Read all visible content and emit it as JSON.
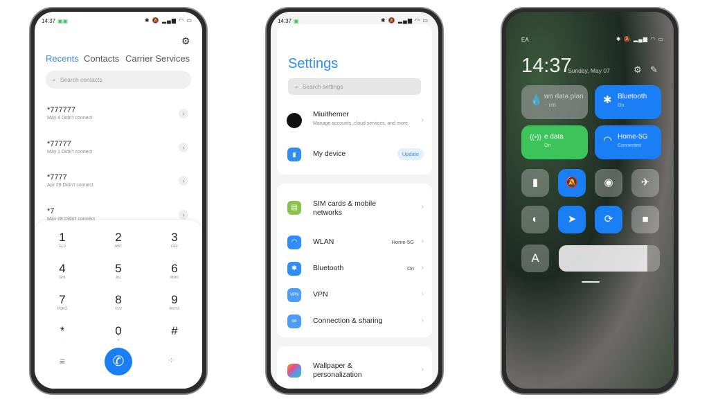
{
  "phone1": {
    "status": {
      "time": "14:37",
      "icons": "✱ 🔕 ▂▄▆ ◠ ▭"
    },
    "tabs": [
      "Recents",
      "Contacts",
      "Carrier Services"
    ],
    "search_placeholder": "Search contacts",
    "calls": [
      {
        "number": "*777777",
        "detail": "May 4 Didn't connect"
      },
      {
        "number": "*77777",
        "detail": "May 1 Didn't connect"
      },
      {
        "number": "*7777",
        "detail": "Apr 29 Didn't connect"
      },
      {
        "number": "*7",
        "detail": "May 28 Didn't connect"
      }
    ],
    "keys": [
      [
        "1",
        "GLD"
      ],
      [
        "2",
        "ABC"
      ],
      [
        "3",
        "DEF"
      ],
      [
        "4",
        "GHI"
      ],
      [
        "5",
        "JKL"
      ],
      [
        "6",
        "MNO"
      ],
      [
        "7",
        "PQRS"
      ],
      [
        "8",
        "TUV"
      ],
      [
        "9",
        "WXYZ"
      ],
      [
        "*",
        "·"
      ],
      [
        "0",
        "+"
      ],
      [
        "#",
        ""
      ]
    ],
    "accent": "#1a7ff5"
  },
  "phone2": {
    "status": {
      "time": "14:37",
      "icons": "✱ 🔕 ▂▄▆ ◠ ▭"
    },
    "title": "Settings",
    "search_placeholder": "Search settings",
    "account": {
      "name": "Miuithemer",
      "desc": "Manage accounts, cloud services, and more"
    },
    "device": {
      "label": "My device",
      "badge": "Update"
    },
    "network": [
      {
        "label": "SIM cards & mobile networks",
        "value": "",
        "color": "#8bc34a",
        "icon": "sim-icon"
      },
      {
        "label": "WLAN",
        "value": "Home-5G",
        "color": "#2f8df5",
        "icon": "wifi-icon"
      },
      {
        "label": "Bluetooth",
        "value": "On",
        "color": "#2f8df5",
        "icon": "bluetooth-icon"
      },
      {
        "label": "VPN",
        "value": "",
        "color": "#4f9cf5",
        "icon": "vpn-icon"
      },
      {
        "label": "Connection & sharing",
        "value": "",
        "color": "#4f9cf5",
        "icon": "link-icon"
      }
    ],
    "personal": [
      {
        "label": "Wallpaper & personalization"
      }
    ]
  },
  "phone3": {
    "carrier": "EA",
    "time": "14:37",
    "date": "Sunday, May 07",
    "tiles": [
      {
        "title": "wn data plan",
        "sub": "-- MB",
        "color": "#8a8f8c"
      },
      {
        "title": "Bluetooth",
        "sub": "On",
        "color": "#1a7ff5"
      },
      {
        "title": "e data",
        "sub": "On",
        "color": "#3cc35a"
      },
      {
        "title": "Home-5G",
        "sub": "Connected",
        "color": "#1a7ff5"
      }
    ],
    "toggles": [
      {
        "name": "flashlight",
        "on": false,
        "glyph": "▮"
      },
      {
        "name": "silent",
        "on": true,
        "glyph": "🔕"
      },
      {
        "name": "screenshot",
        "on": false,
        "glyph": "◉"
      },
      {
        "name": "airplane",
        "on": false,
        "glyph": "✈"
      },
      {
        "name": "dark-mode",
        "on": false,
        "glyph": "◐"
      },
      {
        "name": "location",
        "on": true,
        "glyph": "➤"
      },
      {
        "name": "rotation-lock",
        "on": true,
        "glyph": "⟳"
      },
      {
        "name": "screen-record",
        "on": false,
        "glyph": "■"
      }
    ],
    "font_button": "A",
    "brightness": 0.88
  }
}
